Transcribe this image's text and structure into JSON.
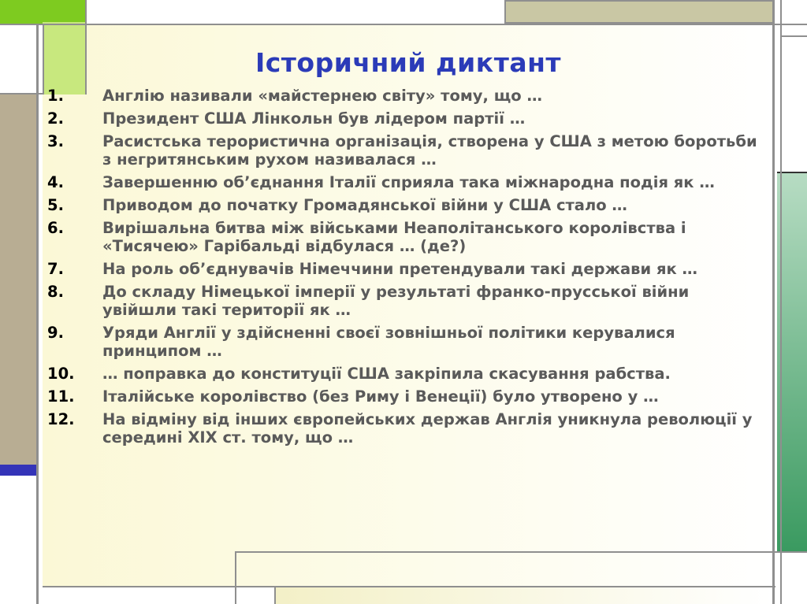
{
  "slide": {
    "title": "Історичний диктант",
    "colors": {
      "title": "#2b3bb8",
      "text": "#5a5a5a",
      "accent_green": "#7ecb20",
      "accent_blue": "#3434b8"
    },
    "items": [
      {
        "num": "1.",
        "text": "Англію називали «майстернею світу» тому, що …"
      },
      {
        "num": "2.",
        "text": "Президент США Лінкольн був лідером партії …"
      },
      {
        "num": "3.",
        "text": "Расистська терористична організація, створена у США з метою боротьби з негритянським рухом називалася …"
      },
      {
        "num": "4.",
        "text": "Завершенню об’єднання Італії сприяла така міжнародна подія як …"
      },
      {
        "num": "5.",
        "text": "Приводом до початку Громадянської війни у США стало …"
      },
      {
        "num": "6.",
        "text": "Вирішальна битва між військами Неаполітанського королівства і «Тисячею» Гарібальді відбулася … (де?)"
      },
      {
        "num": "7.",
        "text": "На роль об’єднувачів Німеччини претендували такі держави як …"
      },
      {
        "num": "8.",
        "text": "До складу Німецької імперії у результаті франко-прусської війни  увійшли такі території як  …"
      },
      {
        "num": "9.",
        "text": "Уряди Англії у здійсненні своєї зовнішньої політики керувалися принципом …"
      },
      {
        "num": "10.",
        "text": "… поправка до конституції США закріпила скасування рабства."
      },
      {
        "num": "11.",
        "text": "Італійське королівство (без Риму і Венеції) було утворено у …"
      },
      {
        "num": "12.",
        "text": "На відміну від інших європейських держав Англія уникнула революції у середині XIX ст. тому, що …"
      }
    ]
  }
}
